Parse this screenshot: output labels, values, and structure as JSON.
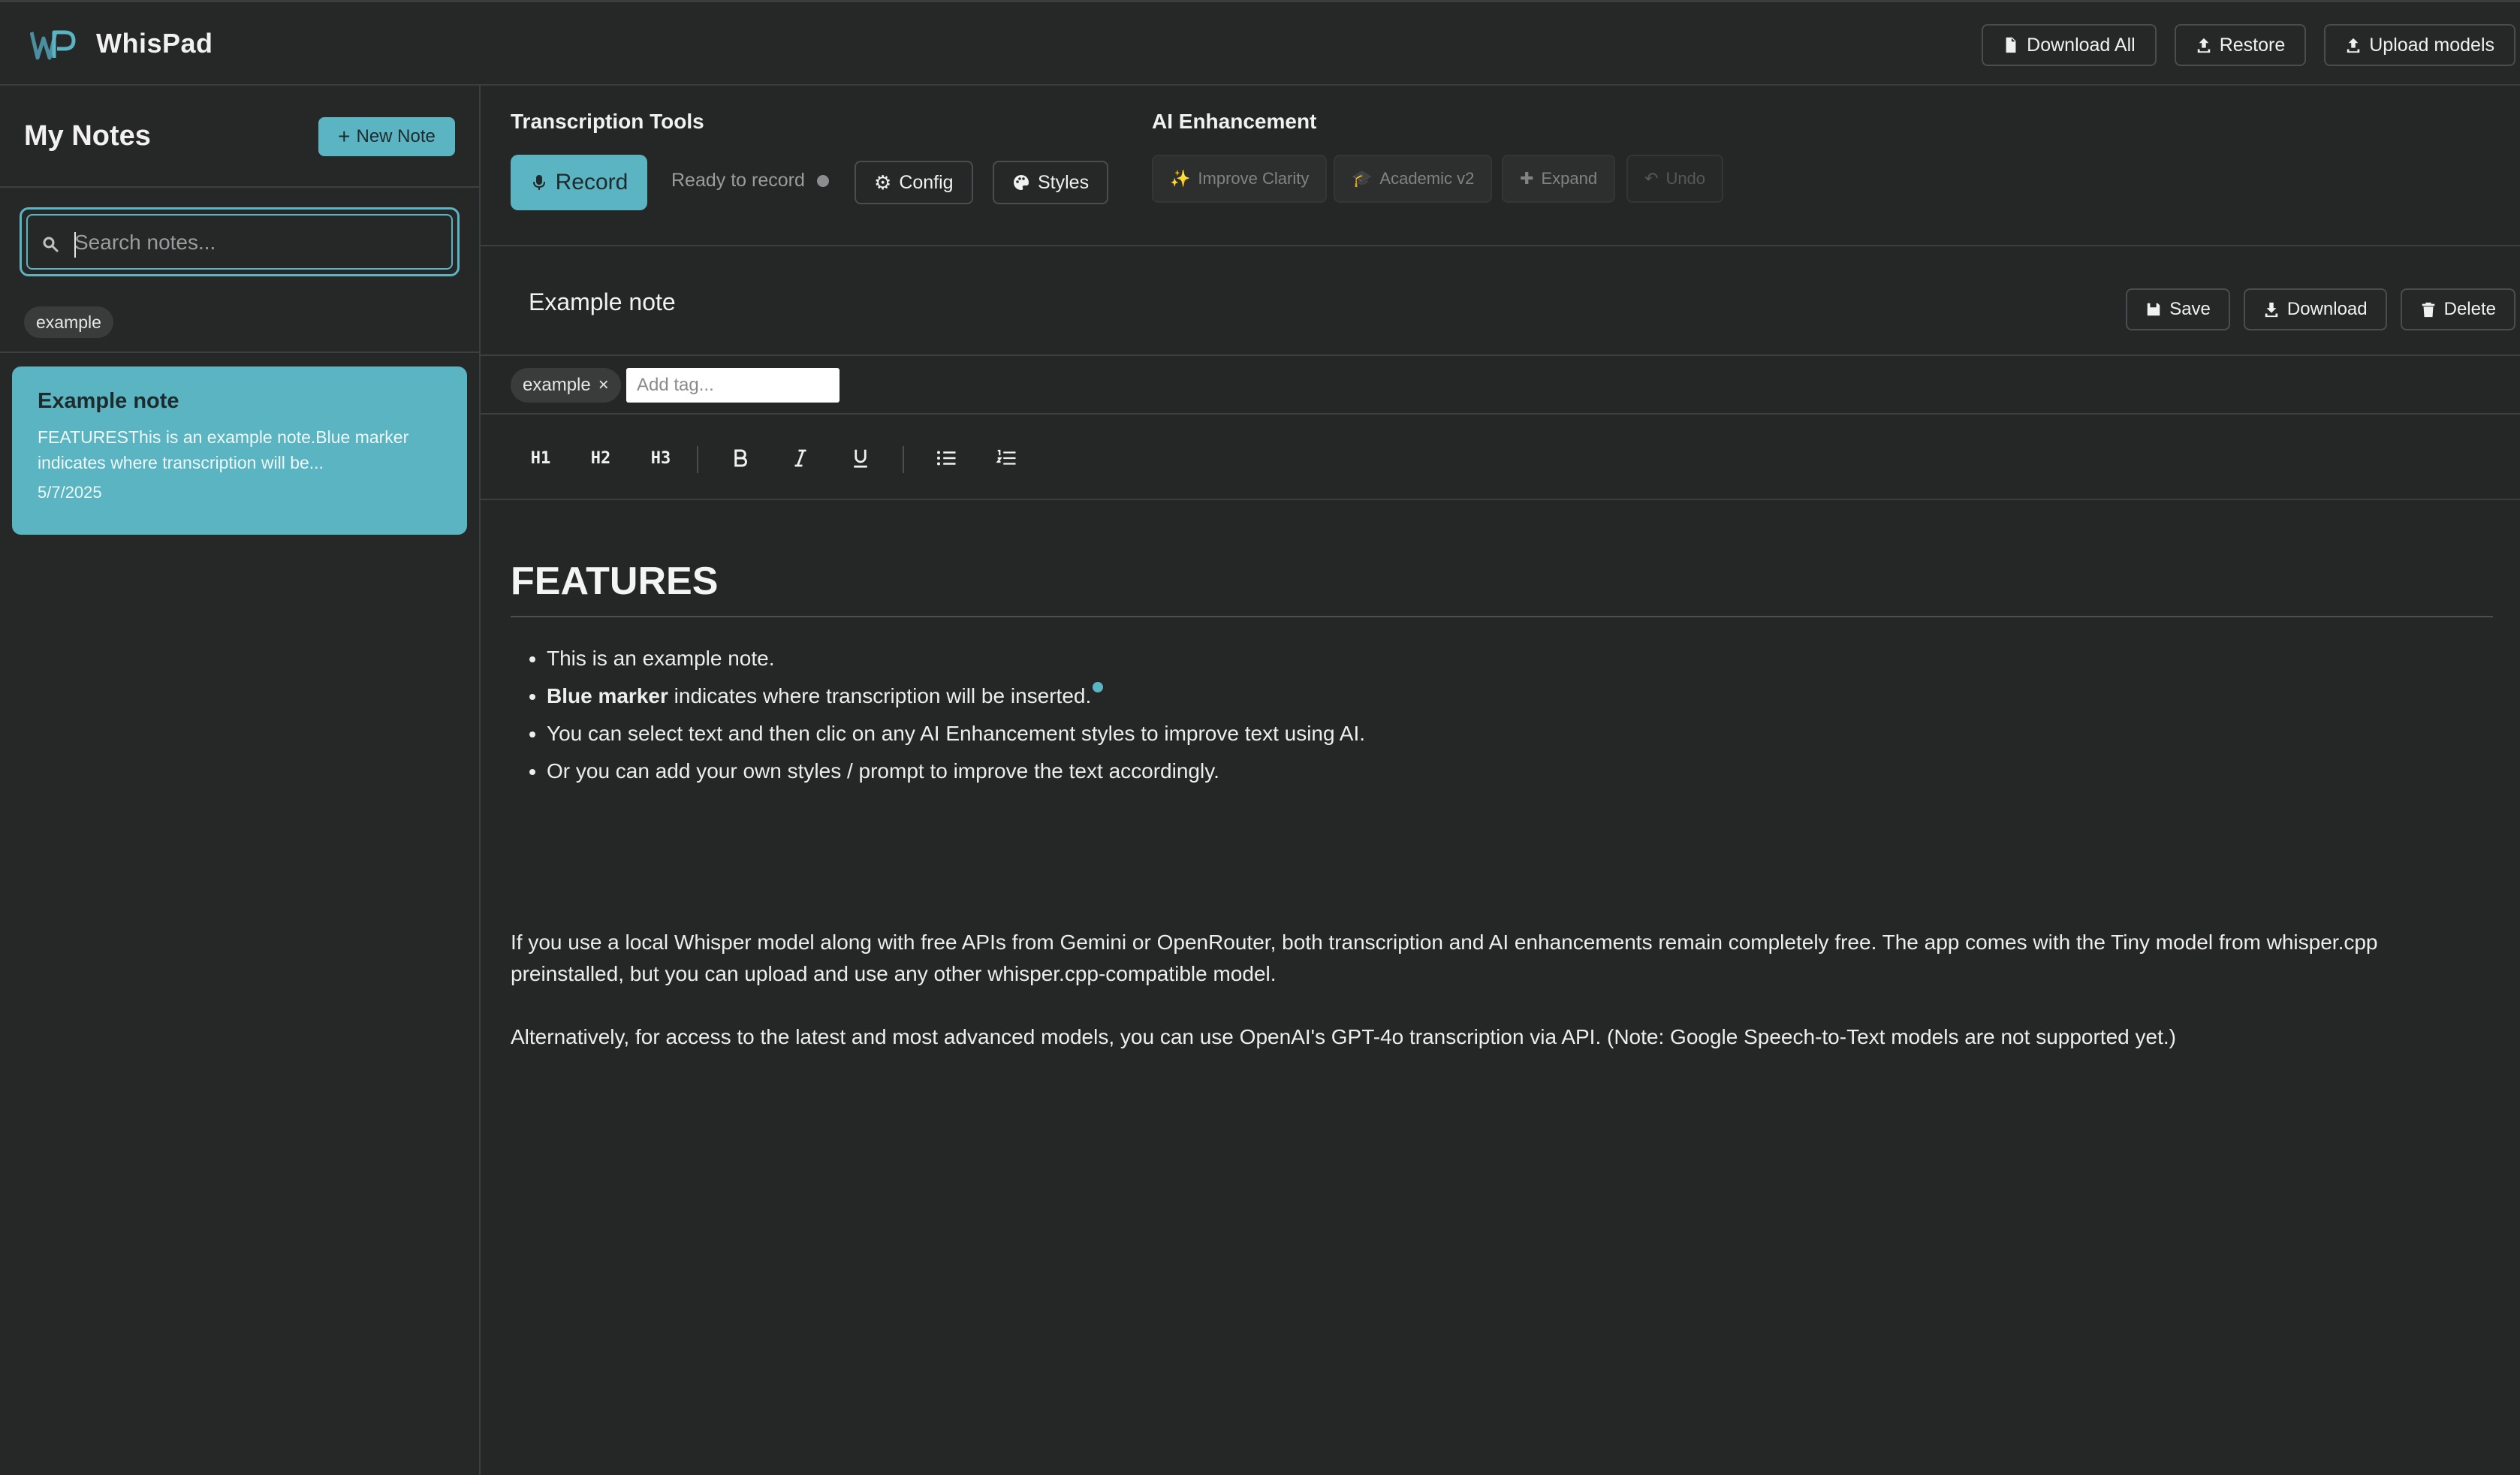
{
  "app": {
    "name": "WhisPad"
  },
  "topbar": {
    "download_all": "Download All",
    "restore": "Restore",
    "upload_models": "Upload models"
  },
  "sidebar": {
    "title": "My Notes",
    "new_note": "New Note",
    "search_placeholder": "Search notes...",
    "tags": [
      "example"
    ],
    "notes": [
      {
        "title": "Example note",
        "preview": "FEATURESThis is an example note.Blue marker indicates where transcription will be...",
        "date": "5/7/2025"
      }
    ]
  },
  "tools": {
    "transcription_label": "Transcription Tools",
    "record": "Record",
    "status": "Ready to record",
    "config": "Config",
    "styles": "Styles",
    "ai_label": "AI Enhancement",
    "improve_clarity": "Improve Clarity",
    "academic": "Academic v2",
    "expand": "Expand",
    "undo": "Undo"
  },
  "note": {
    "title": "Example note",
    "save": "Save",
    "download": "Download",
    "delete": "Delete",
    "tag": "example",
    "tag_remove": "×",
    "tag_placeholder": "Add tag...",
    "format": {
      "h1": "H1",
      "h2": "H2",
      "h3": "H3"
    },
    "content": {
      "heading": "FEATURES",
      "bullet1": "This is an example note.",
      "bullet2_bold": "Blue marker",
      "bullet2_rest": " indicates where transcription will be inserted.",
      "bullet3": "You can select text and then clic on any AI Enhancement styles to improve text using AI.",
      "bullet4": "Or you can add your own styles / prompt to improve the text accordingly.",
      "para1": "If you use a local Whisper model along with free APIs from Gemini or OpenRouter, both transcription and AI enhancements remain completely free. The app comes with the Tiny model from whisper.cpp preinstalled, but you can upload and use any other whisper.cpp-compatible model.",
      "para2": "Alternatively, for access to the latest and most advanced models, you can use OpenAI's GPT-4o transcription via API. (Note: Google Speech-to-Text models are not supported yet.)"
    }
  },
  "colors": {
    "accent": "#5bb4c2",
    "background": "#252727"
  }
}
